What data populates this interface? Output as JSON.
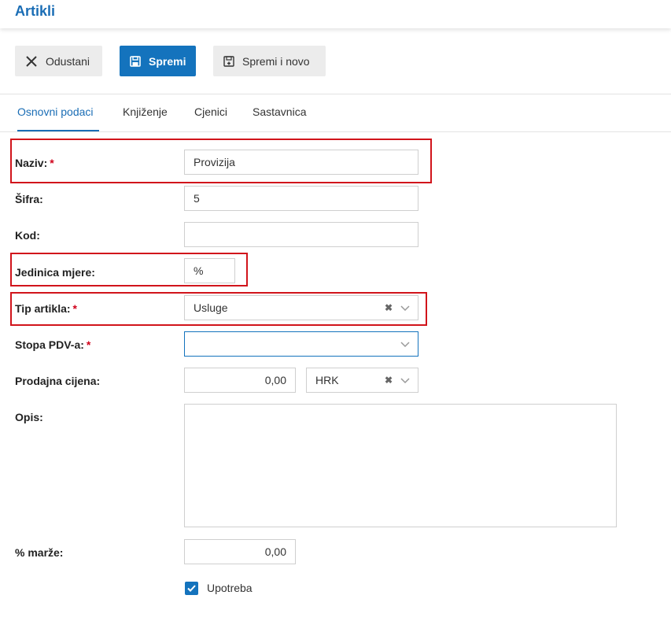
{
  "header": {
    "title": "Artikli"
  },
  "toolbar": {
    "cancel_label": "Odustani",
    "save_label": "Spremi",
    "save_new_label": "Spremi i novo"
  },
  "tabs": [
    {
      "label": "Osnovni podaci",
      "active": true
    },
    {
      "label": "Knjiženje",
      "active": false
    },
    {
      "label": "Cjenici",
      "active": false
    },
    {
      "label": "Sastavnica",
      "active": false
    }
  ],
  "form": {
    "required_mark": "*",
    "naziv": {
      "label": "Naziv:",
      "value": "Provizija"
    },
    "sifra": {
      "label": "Šifra:",
      "value": "5"
    },
    "kod": {
      "label": "Kod:",
      "value": ""
    },
    "jedinica_mjere": {
      "label": "Jedinica mjere:",
      "value": "%"
    },
    "tip_artikla": {
      "label": "Tip artikla:",
      "value": "Usluge"
    },
    "stopa_pdv": {
      "label": "Stopa PDV-a:",
      "value": ""
    },
    "prodajna_cijena": {
      "label": "Prodajna cijena:",
      "value": "0,00",
      "currency": "HRK"
    },
    "opis": {
      "label": "Opis:",
      "value": ""
    },
    "marza": {
      "label": "% marže:",
      "value": "0,00"
    },
    "upotreba": {
      "label": "Upotreba",
      "checked": true
    }
  },
  "colors": {
    "accent": "#1473bd",
    "highlight": "#d1141b",
    "required": "#d0021b"
  }
}
